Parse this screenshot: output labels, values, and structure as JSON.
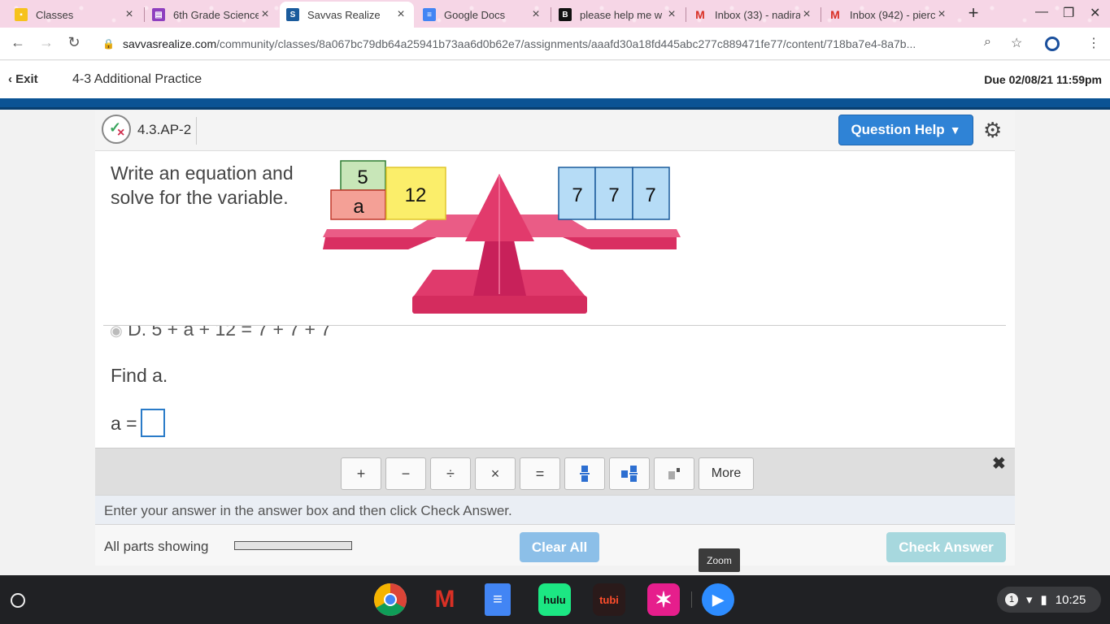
{
  "browser": {
    "tabs": [
      {
        "title": "Classes",
        "favicon": "classroom-icon",
        "color": "#f6c21c"
      },
      {
        "title": "6th Grade Science",
        "favicon": "purple-doc-icon",
        "color": "#8e3fbf"
      },
      {
        "title": "Savvas Realize",
        "favicon": "savvas-icon",
        "color": "#1a5b9c"
      },
      {
        "title": "Google Docs",
        "favicon": "docs-icon",
        "color": "#4285f4"
      },
      {
        "title": "please help me w",
        "favicon": "brainly-icon",
        "color": "#111111"
      },
      {
        "title": "Inbox (33) - nadira",
        "favicon": "gmail-icon",
        "color": "#d93025"
      },
      {
        "title": "Inbox (942) - pierc",
        "favicon": "gmail-icon",
        "color": "#d93025"
      }
    ],
    "url_domain": "savvasrealize.com",
    "url_path": "/community/classes/8a067bc79db64a25941b73aa6d0b62e7/assignments/aaafd30a18fd445abc277c889471fe77/content/718ba7e4-8a7b..."
  },
  "header": {
    "exit_label": "Exit",
    "assignment_title": "4-3 Additional Practice",
    "due": "Due 02/08/21 11:59pm"
  },
  "question": {
    "id": "4.3.AP-2",
    "help_label": "Question Help",
    "prompt": "Write an equation and solve for the variable.",
    "scale": {
      "left_blocks": [
        "5",
        "a",
        "12"
      ],
      "right_blocks": [
        "7",
        "7",
        "7"
      ]
    },
    "choice_d": "D.  5 + a + 12 = 7 + 7 + 7",
    "find_label": "Find a.",
    "answer_label": "a =",
    "answer_value": ""
  },
  "mathbar": {
    "buttons": [
      "+",
      "−",
      "÷",
      "×",
      "="
    ],
    "more_label": "More"
  },
  "hint": "Enter your answer in the answer box and then click Check Answer.",
  "footer": {
    "all_parts": "All parts showing",
    "progress_fraction": 0,
    "clear_all": "Clear All",
    "check_answer": "Check Answer"
  },
  "taskbar": {
    "tooltip": "Zoom",
    "apps": [
      "chrome",
      "gmail",
      "docs",
      "hulu",
      "tubi",
      "star",
      "zoom"
    ],
    "hulu_label": "hulu",
    "tubi_label": "tubi",
    "notifications": "1",
    "time": "10:25"
  }
}
